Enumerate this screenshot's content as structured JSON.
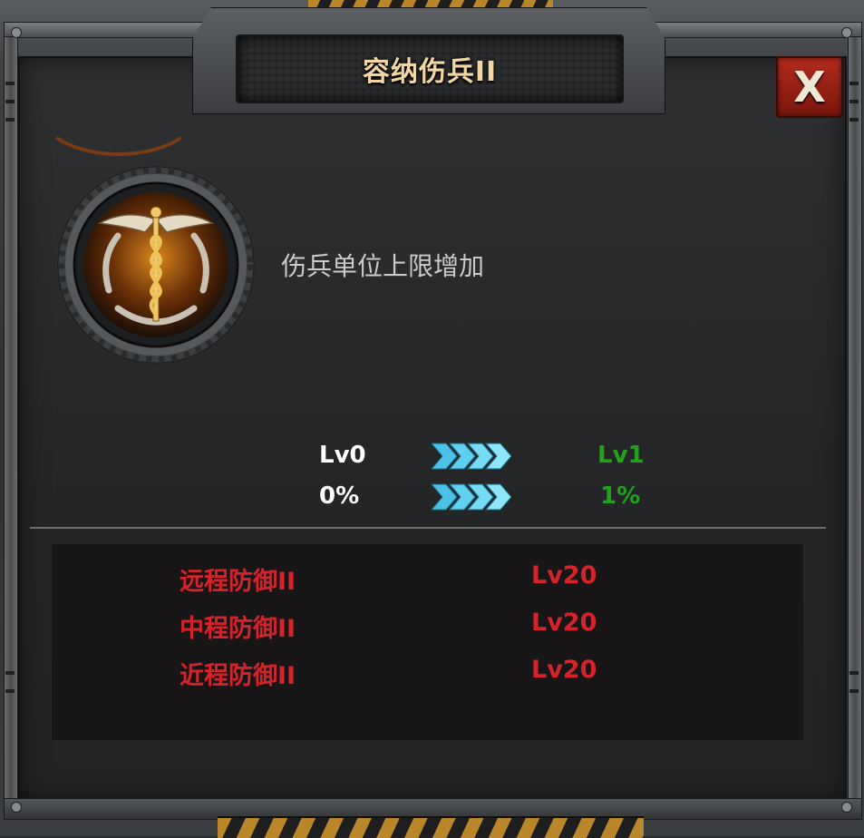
{
  "dialog": {
    "title": "容纳伤兵II",
    "close_label": "X",
    "skill_icon": "medic-caduceus-icon",
    "description": "伤兵单位上限增加"
  },
  "upgrade": {
    "current_level": "Lv0",
    "next_level": "Lv1",
    "current_value": "0%",
    "next_value": "1%",
    "arrow_icon": "chevron-arrows-icon"
  },
  "requirements": [
    {
      "name": "远程防御II",
      "level": "Lv20"
    },
    {
      "name": "中程防御II",
      "level": "Lv20"
    },
    {
      "name": "近程防御II",
      "level": "Lv20"
    }
  ],
  "colors": {
    "title": "#f3d6a2",
    "current": "#ffffff",
    "next": "#22a11b",
    "requirement": "#d6232a",
    "close_button": "#b12a1d",
    "arrows": "#4cc3e6"
  }
}
